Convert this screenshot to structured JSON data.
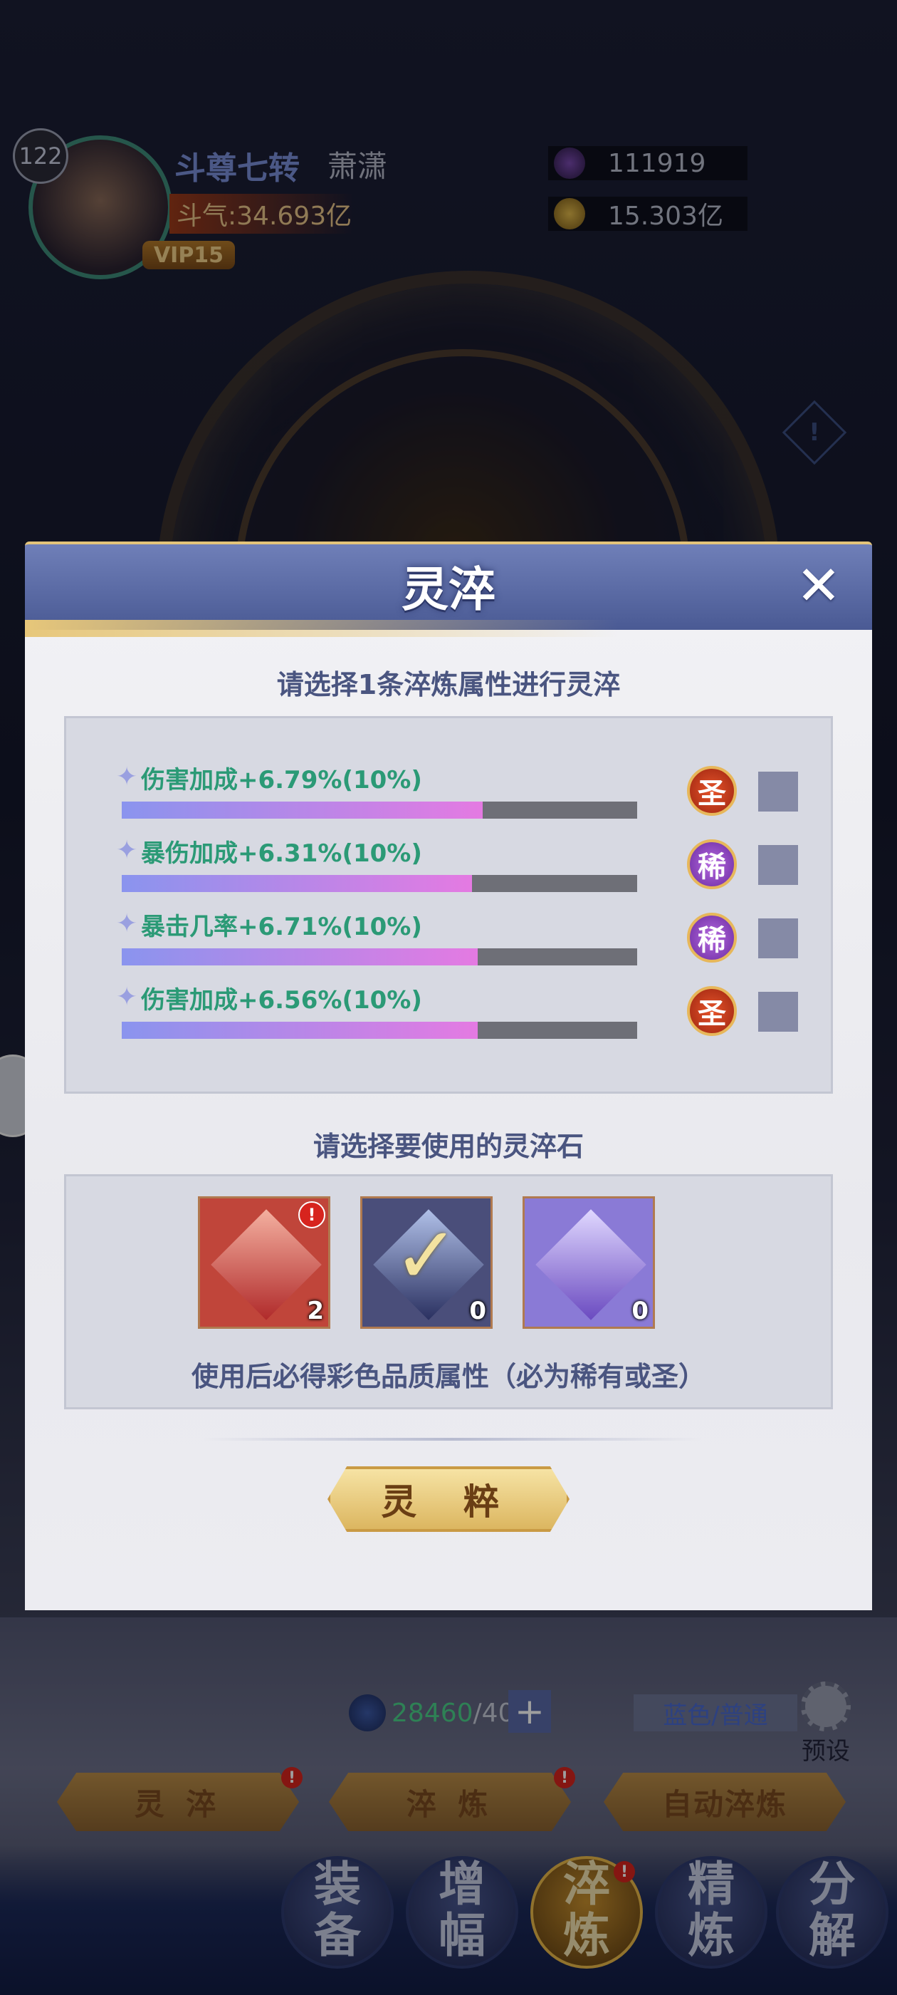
{
  "player": {
    "level": "122",
    "rank": "斗尊七转",
    "name": "萧潇",
    "power": "斗气:34.693亿",
    "vip": "VIP15"
  },
  "resources": [
    {
      "name": "resource-1",
      "value": "111919"
    },
    {
      "name": "resource-2",
      "value": "15.303亿"
    }
  ],
  "popup": {
    "title": "灵淬",
    "close": "✕",
    "attr_prompt": "请选择1条淬炼属性进行灵淬",
    "attributes": [
      {
        "label": "伤害加成+6.79%(10%)",
        "progress": 0.7,
        "quality": "圣"
      },
      {
        "label": "暴伤加成+6.31%(10%)",
        "progress": 0.68,
        "quality": "稀"
      },
      {
        "label": "暴击几率+6.71%(10%)",
        "progress": 0.69,
        "quality": "稀"
      },
      {
        "label": "伤害加成+6.56%(10%)",
        "progress": 0.69,
        "quality": "圣"
      }
    ],
    "stone_prompt": "请选择要使用的灵淬石",
    "stones": [
      {
        "count": "2",
        "color": "#c0453a",
        "alert": "!"
      },
      {
        "count": "0",
        "color": "#4a4e7a",
        "selected": true
      },
      {
        "count": "0",
        "color": "#8a7ad6"
      }
    ],
    "stone_desc": "使用后必得彩色品质属性（必为稀有或圣）",
    "confirm": "灵 粹"
  },
  "bottom": {
    "stone_count": "28460",
    "stone_need": "/40",
    "quality_select": "蓝色/普通",
    "preset": "预设",
    "tabs": [
      "灵 淬",
      "淬 炼",
      "自动淬炼"
    ],
    "nav": [
      {
        "top": "装",
        "bottom": "备"
      },
      {
        "top": "增",
        "bottom": "幅"
      },
      {
        "top": "淬",
        "bottom": "炼"
      },
      {
        "top": "精",
        "bottom": "炼"
      },
      {
        "top": "分",
        "bottom": "解"
      }
    ]
  },
  "colors": {
    "accent": "#4a5a94",
    "attr_text": "#2b9a76",
    "sheng": "#c8381a",
    "xi": "#8a3ac0"
  }
}
